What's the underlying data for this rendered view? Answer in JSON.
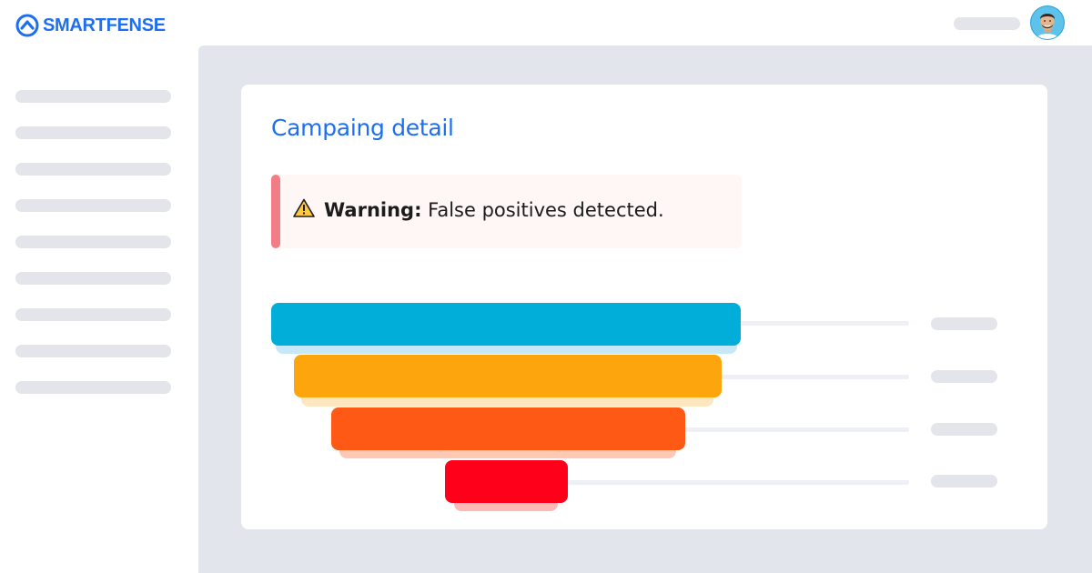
{
  "app": {
    "brand_name": "SMARTFENSE",
    "brand_color": "#1e6ff0",
    "logo_icon": "shield-arrow-icon",
    "avatar_icon": "user-avatar-icon"
  },
  "sidebar": {
    "item_count": 9,
    "placeholder_color": "#e3e5ea"
  },
  "card": {
    "title": "Campaing detail",
    "title_color": "#1e6ff0"
  },
  "alert": {
    "icon": "warning-triangle-icon",
    "label": "Warning:",
    "message": "False positives detected.",
    "accent_color": "#f37d86",
    "background": "#fff6f6"
  },
  "funnel": {
    "stages": [
      {
        "color": "#00aed9",
        "shadow_color": "#c6e8f7",
        "level": 1.0
      },
      {
        "color": "#fca50c",
        "shadow_color": "#fde7c0",
        "level": 0.91
      },
      {
        "color": "#fe5a16",
        "shadow_color": "#fec9b4",
        "level": 0.75
      },
      {
        "color": "#ff001a",
        "shadow_color": "#ffb8b5",
        "level": 0.26
      }
    ]
  }
}
